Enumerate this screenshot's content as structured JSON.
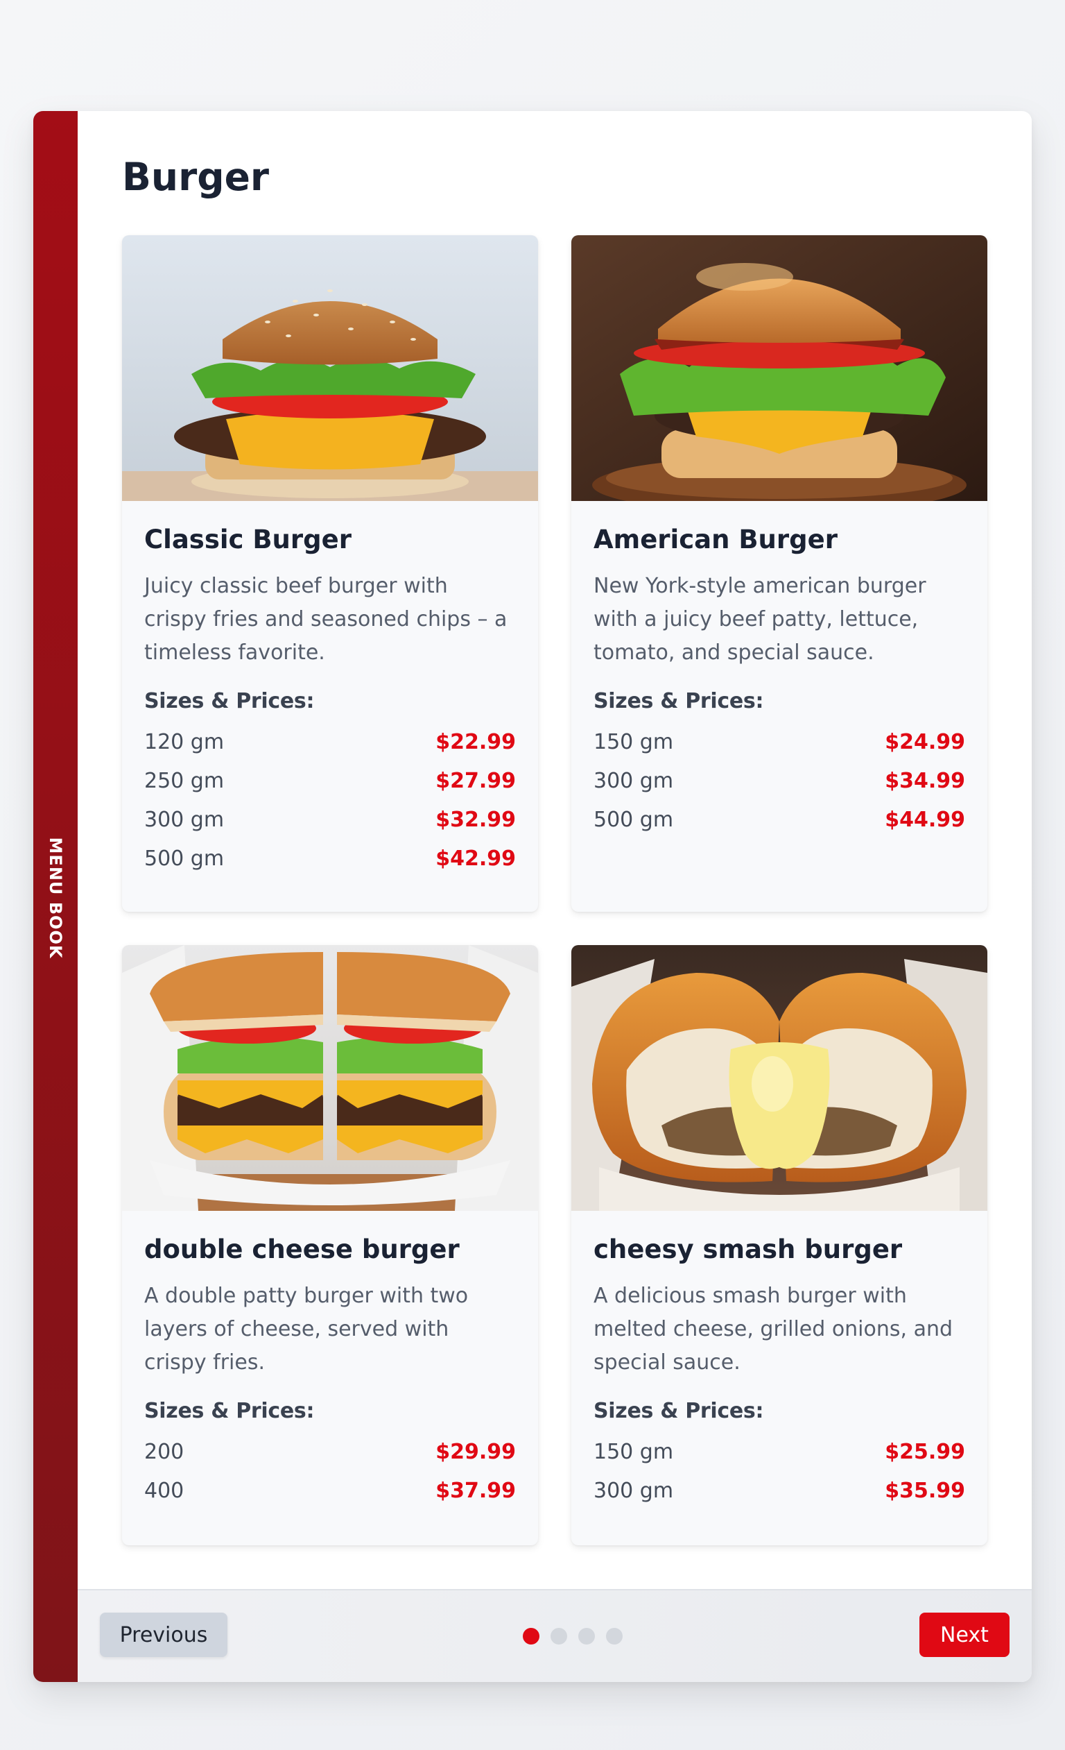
{
  "spine": {
    "label": "MENU BOOK"
  },
  "page": {
    "title": "Burger"
  },
  "section": {
    "sizes_label": "Sizes & Prices:"
  },
  "items": [
    {
      "name": "Classic Burger",
      "description": "Juicy classic beef burger with crispy fries and seasoned chips – a timeless favorite.",
      "image": "classic-burger-photo",
      "sizes": [
        {
          "size": "120 gm",
          "price": "$22.99"
        },
        {
          "size": "250 gm",
          "price": "$27.99"
        },
        {
          "size": "300 gm",
          "price": "$32.99"
        },
        {
          "size": "500 gm",
          "price": "$42.99"
        }
      ]
    },
    {
      "name": "American Burger",
      "description": "New York-style american burger with a juicy beef patty, lettuce, tomato, and special sauce.",
      "image": "american-burger-photo",
      "sizes": [
        {
          "size": "150 gm",
          "price": "$24.99"
        },
        {
          "size": "300 gm",
          "price": "$34.99"
        },
        {
          "size": "500 gm",
          "price": "$44.99"
        }
      ]
    },
    {
      "name": "double cheese burger",
      "description": "A double patty burger with two layers of cheese, served with crispy fries.",
      "image": "double-cheese-burger-photo",
      "sizes": [
        {
          "size": "200",
          "price": "$29.99"
        },
        {
          "size": "400",
          "price": "$37.99"
        }
      ]
    },
    {
      "name": "cheesy smash burger",
      "description": "A delicious smash burger with melted cheese, grilled onions, and special sauce.",
      "image": "cheesy-smash-burger-photo",
      "sizes": [
        {
          "size": "150 gm",
          "price": "$25.99"
        },
        {
          "size": "300 gm",
          "price": "$35.99"
        }
      ]
    }
  ],
  "pagination": {
    "prev_label": "Previous",
    "next_label": "Next",
    "total_pages": 4,
    "current_page": 1
  },
  "colors": {
    "accent": "#e00914",
    "spine": "#a30d16",
    "title": "#1a2233"
  }
}
